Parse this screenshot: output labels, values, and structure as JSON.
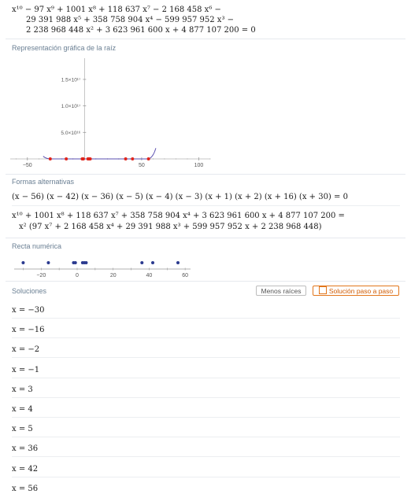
{
  "equation": {
    "line1": "x¹⁰ − 97 x⁹ + 1001 x⁸ + 118 637 x⁷ − 2 168 458 x⁶ −",
    "line2": "29 391 988 x⁵ + 358 758 904 x⁴ − 599 957 952 x³ −",
    "line3": "2 238 968 448 x² + 3 623 961 600 x + 4 877 107 200 = 0"
  },
  "plot_section": {
    "title": "Representación gráfica de la raíz",
    "y_tick_labels": [
      "1.5×10¹⁷",
      "1.0×10¹⁷",
      "5.0×10¹⁶"
    ],
    "x_tick_labels": [
      "−50",
      "50",
      "100"
    ],
    "curve_color": "#5a4fb0",
    "root_color": "#e0251b"
  },
  "alt_forms": {
    "title": "Formas alternativas",
    "factored": "(x − 56) (x − 42) (x − 36) (x − 5) (x − 4) (x − 3) (x + 1) (x + 2) (x + 16) (x + 30) = 0",
    "expanded_line1": "x¹⁰ + 1001 x⁸ + 118 637 x⁷ + 358 758 904 x⁴ + 3 623 961 600 x + 4 877 107 200 =",
    "expanded_line2": "x² (97 x⁷ + 2 168 458 x⁴ + 29 391 988 x³ + 599 957 952 x + 2 238 968 448)"
  },
  "number_line": {
    "title": "Recta numérica",
    "tick_labels": [
      "−20",
      "0",
      "20",
      "40",
      "60"
    ],
    "dot_color": "#2b3a8f"
  },
  "solutions": {
    "title": "Soluciones",
    "less_roots_label": "Menos raíces",
    "step_by_step_label": "Solución paso a paso",
    "items": [
      "x = −30",
      "x = −16",
      "x = −2",
      "x = −1",
      "x = 3",
      "x = 4",
      "x = 5",
      "x = 36",
      "x = 42",
      "x = 56"
    ]
  },
  "chart_data": {
    "type": "line",
    "title": "",
    "xlabel": "",
    "ylabel": "",
    "xlim": [
      -65,
      110
    ],
    "ylim": [
      0,
      1.9e+17
    ],
    "roots": [
      -30,
      -16,
      -2,
      -1,
      3,
      4,
      5,
      36,
      42,
      56
    ],
    "number_line_points": [
      -30,
      -16,
      -2,
      -1,
      3,
      4,
      5,
      36,
      42,
      56
    ],
    "number_line_xlim": [
      -30,
      60
    ]
  }
}
